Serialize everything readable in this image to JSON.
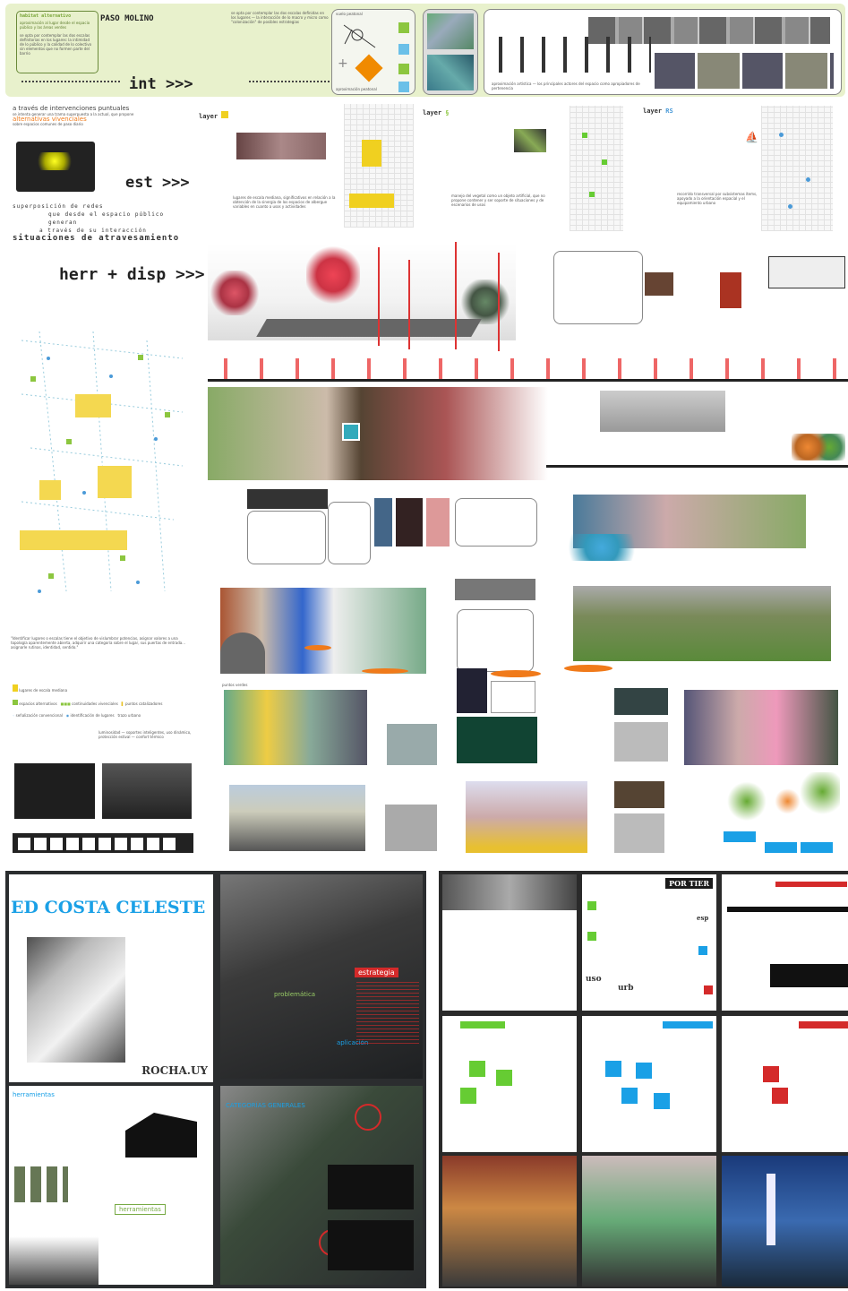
{
  "header": {
    "subtitle": "habitat alternativo",
    "title": "PASO MOLINO",
    "lead": "aproximación al lugar desde el espacio público y las áreas verdes",
    "body": "se opta por contemplar las dos escalas definitorias en los lugares: la intimidad de lo público y la calidad de lo colectivo sin elementos que no formen parte del barrio",
    "nav_int": "int >>>",
    "mid_text": "se opta por contemplar las dos escalas definidas en los lugares — la interacción de lo macro y micro como \"colonización\" de posibles estrategias",
    "legend_top": "vuelo peatonal",
    "legend_bottom": "aproximación peatonal",
    "caption_photos": "aproximación artística — los principales actores del espacio como apropiadores de pertenencia"
  },
  "left": {
    "intro_lead": "a través de intervenciones puntuales",
    "intro_2": "se intenta generar una trama superpuesta a la actual, que propone",
    "intro_3": "alternativas vivenciales",
    "intro_4": "sobre espacios comunes de paso diario",
    "nav_est": "est >>>",
    "net_line1": "superposición de redes",
    "net_line2": "que desde el espacio público generan",
    "net_line3": "a través de su interacción",
    "net_line4": "situaciones de atravesamiento",
    "nav_herr": "herr + disp >>>",
    "quote": "\"Identificar lugares o escalas tiene el objetivo de vislumbrar potencias, asignar valores a una topología aparentemente abierta, adquirir una categoría sobre el lugar, sus puertas de entrada... asignarle rutinas, identidad, sentido.\"",
    "legend": [
      "lugares de escala mediana",
      "espacios alternativos",
      "continuidades vivenciales",
      "puntos catalizadores",
      "señalización convencional",
      "identificación de lugares",
      "trazo urbano"
    ],
    "footnote": "luminosidad — soportes inteligentes, uso dinámico, protección estival — confort térmico"
  },
  "layers": {
    "layer1": "layer",
    "layer2": "layer",
    "layer3": "layer",
    "desc1": "lugares de escala mediana, significativos en relación a la obtención de la sinergia de los espacios de albergue variables en cuanto a usos y actividades",
    "desc2": "manejo del vegetal como un objeto artificial, que no propone contener y ser soporte de situaciones y de escenarios de usos",
    "desc3": "recorrido transversal por subsistemas ítems, apoyado a la orientación espacial y el equipamiento urbano"
  },
  "section_labels": {
    "lugares": "lugares",
    "puntos_verdes": "puntos verdes"
  },
  "bottom_left": {
    "title": "ED COSTA CELESTE",
    "footer": "ROCHA.UY",
    "tag_estrategia": "estrategia",
    "tag_problematica": "problemática",
    "tag_aplicacion": "aplicación",
    "tag_herramientas": "herramientas",
    "tag_categorias": "CATEGORÍAS GENERALES"
  },
  "bottom_right": {
    "title": "POR TIER",
    "label_uso": "uso",
    "label_urb": "urb",
    "label_esp": "esp"
  },
  "colors": {
    "accent_green": "#8cc63f",
    "accent_yellow": "#f0d020",
    "accent_orange": "#f07a1a",
    "accent_blue": "#1aa0e6",
    "accent_red": "#d42a2a"
  }
}
